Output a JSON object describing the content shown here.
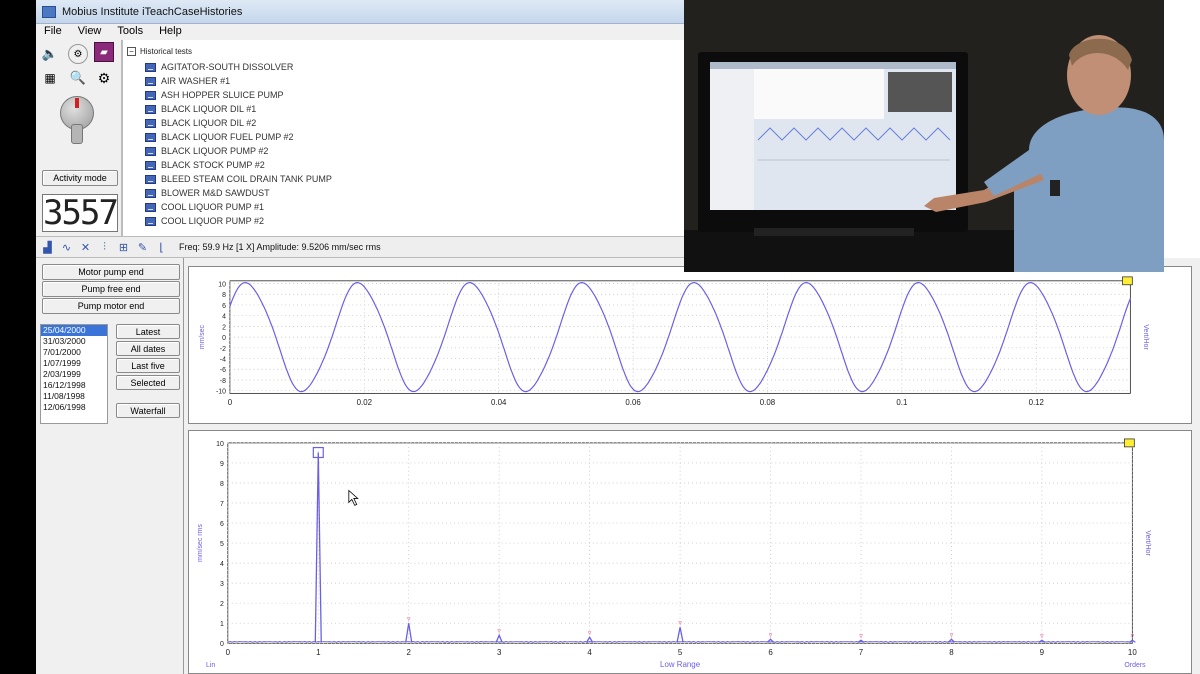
{
  "window": {
    "title": "Mobius Institute iTeachCaseHistories"
  },
  "menu": [
    "File",
    "View",
    "Tools",
    "Help"
  ],
  "activity_mode_label": "Activity mode",
  "counter_value": "3557",
  "tree": {
    "root_label": "Historical tests",
    "items": [
      "AGITATOR-SOUTH DISSOLVER",
      "AIR WASHER #1",
      "ASH HOPPER SLUICE PUMP",
      "BLACK LIQUOR DIL #1",
      "BLACK LIQUOR DIL #2",
      "BLACK LIQUOR FUEL PUMP #2",
      "BLACK LIQUOR PUMP #2",
      "BLACK STOCK PUMP #2",
      "BLEED STEAM COIL DRAIN TANK PUMP",
      "BLOWER M&D SAWDUST",
      "COOL LIQUOR PUMP #1",
      "COOL LIQUOR PUMP #2"
    ]
  },
  "infobar": {
    "text": "Freq: 59.9 Hz  [1 X]  Amplitude: 9.5206 mm/sec rms"
  },
  "points": [
    "Motor pump end",
    "Pump free end",
    "Pump motor end"
  ],
  "dates": [
    "25/04/2000",
    "31/03/2000",
    "7/01/2000",
    "1/07/1999",
    "2/03/1999",
    "16/12/1998",
    "11/08/1998",
    "12/06/1998"
  ],
  "date_buttons": {
    "latest": "Latest",
    "all_dates": "All dates",
    "last_five": "Last five",
    "selected": "Selected",
    "waterfall": "Waterfall"
  },
  "colors": {
    "trace": "#6a5fe8",
    "marker": "#e04080",
    "selection": "#3a74d8"
  },
  "chart_data": [
    {
      "type": "line",
      "title": "",
      "xlabel": "",
      "ylabel": "mm/sec",
      "right_label": "Vert/Hor",
      "xlim": [
        0,
        0.134
      ],
      "ylim": [
        -10.5,
        10.5
      ],
      "x_ticks": [
        "0",
        "0.02",
        "0.04",
        "0.06",
        "0.08",
        "0.1",
        "0.12"
      ],
      "y_ticks": [
        "10",
        "8",
        "6",
        "4",
        "2",
        "0",
        "-2",
        "-4",
        "-6",
        "-8",
        "-10"
      ],
      "series": [
        {
          "frequency_hz": 59.9,
          "amplitude": 10,
          "phase_deg": 35
        }
      ]
    },
    {
      "type": "line",
      "title": "",
      "xlabel": "Low Range",
      "x_unit_left": "Lin",
      "x_unit_right": "Orders",
      "ylabel": "mm/sec rms",
      "right_label": "Vert/Hor",
      "xlim": [
        0,
        10
      ],
      "ylim": [
        0,
        10
      ],
      "x_ticks": [
        "0",
        "1",
        "2",
        "3",
        "4",
        "5",
        "6",
        "7",
        "8",
        "9",
        "10"
      ],
      "y_ticks": [
        "10",
        "9",
        "8",
        "7",
        "6",
        "5",
        "4",
        "3",
        "2",
        "1",
        "0"
      ],
      "peaks": [
        {
          "order": 1,
          "value": 9.52
        },
        {
          "order": 2,
          "value": 1.0
        },
        {
          "order": 3,
          "value": 0.4
        },
        {
          "order": 4,
          "value": 0.3
        },
        {
          "order": 5,
          "value": 0.8
        },
        {
          "order": 6,
          "value": 0.2
        },
        {
          "order": 7,
          "value": 0.15
        },
        {
          "order": 8,
          "value": 0.2
        },
        {
          "order": 9,
          "value": 0.15
        },
        {
          "order": 10,
          "value": 0.15
        }
      ]
    }
  ]
}
